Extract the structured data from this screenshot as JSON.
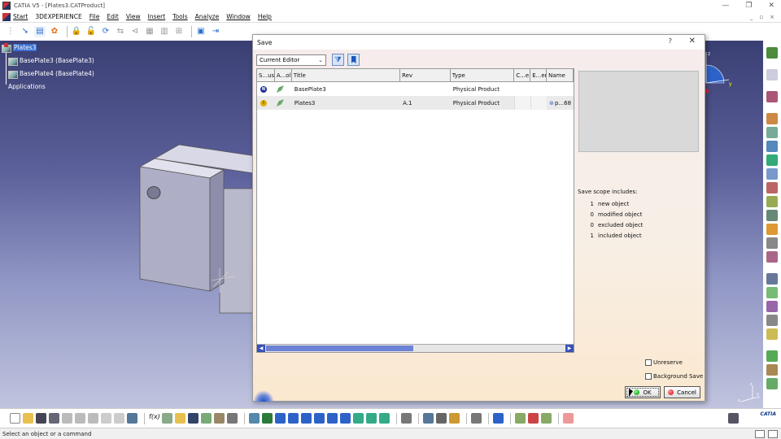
{
  "window": {
    "title": "CATIA V5 - [Plates3.CATProduct]",
    "controls": [
      "—",
      "❐",
      "✕"
    ]
  },
  "menu": {
    "items": [
      "Start",
      "3DEXPERIENCE",
      "File",
      "Edit",
      "View",
      "Insert",
      "Tools",
      "Analyze",
      "Window",
      "Help"
    ],
    "mdi_controls": [
      "_",
      "▫",
      "×"
    ]
  },
  "tree": {
    "root": "Plates3",
    "children": [
      "BasePlate3 (BasePlate3)",
      "BasePlate4 (BasePlate4)",
      "Applications"
    ]
  },
  "save_dialog": {
    "title": "Save",
    "help": "?",
    "close": "✕",
    "filter": "Current Editor",
    "columns": [
      "S...us",
      "A...ol",
      "Title",
      "Rev",
      "Type",
      "C...e",
      "E...er",
      "Name"
    ],
    "rows": [
      {
        "status": "N",
        "title": "BasePlate3",
        "rev": "",
        "type": "Physical Product",
        "c": "",
        "e": "",
        "name": ""
      },
      {
        "status": "!",
        "title": "Plates3",
        "rev": "A.1",
        "type": "Physical Product",
        "c": "",
        "e": "",
        "name": "p...68"
      }
    ],
    "scope": {
      "title": "Save scope includes:",
      "lines": [
        {
          "num": "1",
          "label": "new object"
        },
        {
          "num": "0",
          "label": "modified object"
        },
        {
          "num": "0",
          "label": "excluded object"
        },
        {
          "num": "1",
          "label": "included object"
        }
      ]
    },
    "unreserve_label": "Unreserve",
    "background_save_label": "Background Save",
    "ok_label": "OK",
    "cancel_label": "Cancel"
  },
  "status_bar": {
    "message": "Select an object or a command"
  },
  "catia_logo": "CATIA",
  "compass": {
    "x_label": "x",
    "y_label": "y",
    "z_label": "z"
  },
  "triad": {
    "x_label": "x",
    "y_label": "y",
    "z_label": "z"
  },
  "colors": {
    "selection": "#3b6fd1",
    "scroll_thumb": "#6c82d6",
    "status_new": "#1c2f9b",
    "status_modified": "#e0b000"
  }
}
